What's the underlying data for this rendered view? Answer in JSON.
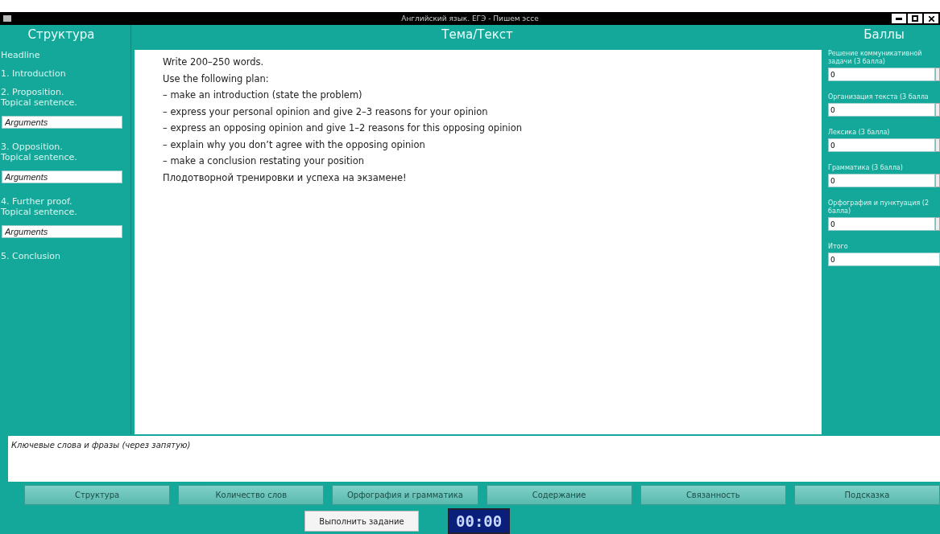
{
  "window": {
    "title": "Английский язык. ЕГЭ - Пишем эссе"
  },
  "structure": {
    "title": "Структура",
    "items": [
      {
        "kind": "label",
        "text": "Headline"
      },
      {
        "kind": "label",
        "text": "1. Introduction"
      },
      {
        "kind": "label",
        "text": "2. Proposition.\nTopical sentence."
      },
      {
        "kind": "field",
        "placeholder": "Arguments"
      },
      {
        "kind": "label",
        "text": "3. Opposition.\nTopical sentence."
      },
      {
        "kind": "field",
        "placeholder": "Arguments"
      },
      {
        "kind": "label",
        "text": "4. Further proof.\nTopical sentence."
      },
      {
        "kind": "field",
        "placeholder": "Arguments"
      },
      {
        "kind": "label",
        "text": "5. Conclusion"
      }
    ]
  },
  "task": {
    "title": "Тема/Текст",
    "lines": [
      "Write 200–250 words.",
      "Use the following plan:",
      "– make an introduction (state the problem)",
      "– express your personal opinion and give 2–3 reasons for your opinion",
      "– express an opposing opinion and give 1–2 reasons for this opposing opinion",
      "– explain why you don’t agree with the opposing opinion",
      "– make a conclusion restating your position",
      "Плодотворной тренировки и успеха на экзамене!"
    ]
  },
  "scores": {
    "title": "Баллы",
    "items": [
      {
        "label": "Решение коммуникативной задачи (3 балла)",
        "value": "0",
        "spinner": true
      },
      {
        "label": "Организация текста (3 балла",
        "value": "0",
        "spinner": true
      },
      {
        "label": "Лексика (3 балла)",
        "value": "0",
        "spinner": true
      },
      {
        "label": "Грамматика (3 балла)",
        "value": "0",
        "spinner": true
      },
      {
        "label": "Орфография и пунктуация (2 балла)",
        "value": "0",
        "spinner": true
      },
      {
        "label": "Итого",
        "value": "0",
        "spinner": false
      }
    ]
  },
  "keywords": {
    "placeholder": "Ключевые слова и фразы (через запятую)"
  },
  "buttons": [
    "Структура",
    "Количество слов",
    "Орфография и грамматика",
    "Содержание",
    "Связанность",
    "Подсказка"
  ],
  "submit": "Выполнить задание",
  "timer": "00:00"
}
